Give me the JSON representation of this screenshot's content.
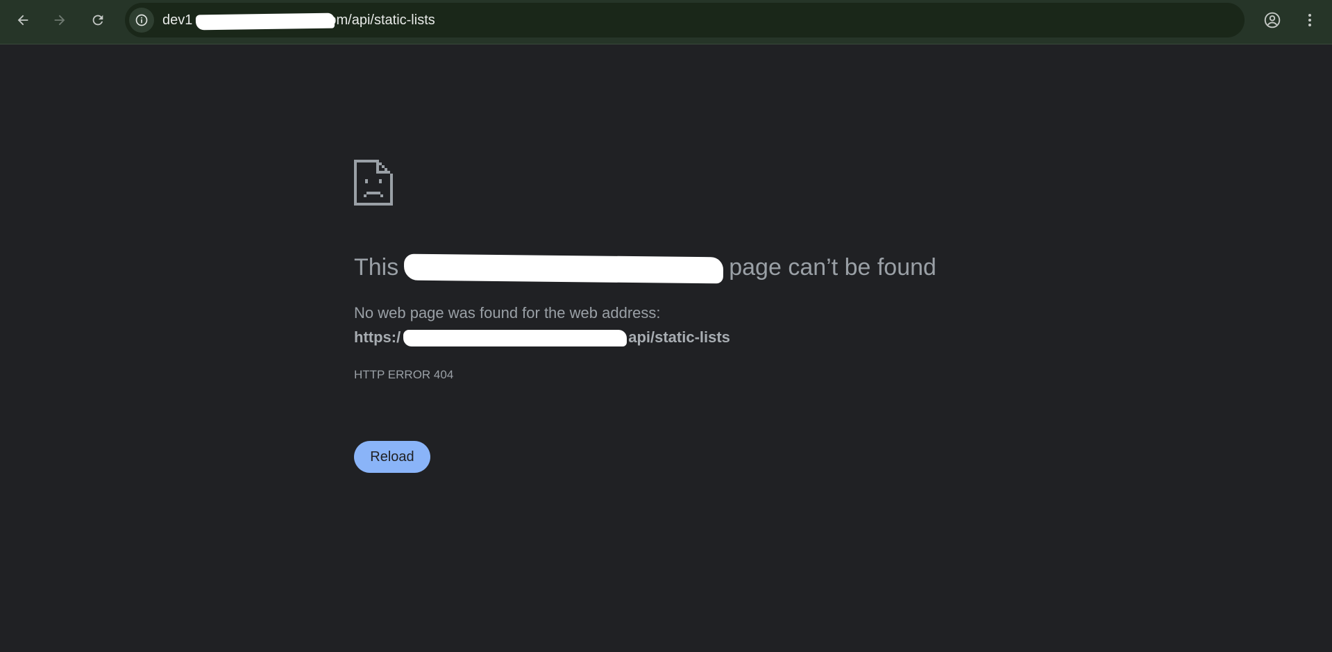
{
  "toolbar": {
    "url_prefix": "dev1",
    "url_suffix": "om/api/static-lists"
  },
  "icons": {
    "back": "back-arrow-icon",
    "forward": "forward-arrow-icon",
    "reload": "reload-icon",
    "site_info": "info-icon",
    "bookmark": "star-icon",
    "profile": "profile-icon",
    "menu": "more-vert-icon",
    "error": "sad-page-icon"
  },
  "error_page": {
    "headline_prefix": "This",
    "headline_suffix": "page can’t be found",
    "description": "No web page was found for the web address:",
    "address_prefix": "https:/",
    "address_suffix": "api/static-lists",
    "error_code": "HTTP ERROR 404",
    "reload_label": "Reload"
  },
  "colors": {
    "page_background": "#202124",
    "toolbar_background": "#263528",
    "omnibox_background": "#1a2719",
    "text_secondary": "#9aa0a6",
    "button_primary": "#8ab4f8"
  }
}
